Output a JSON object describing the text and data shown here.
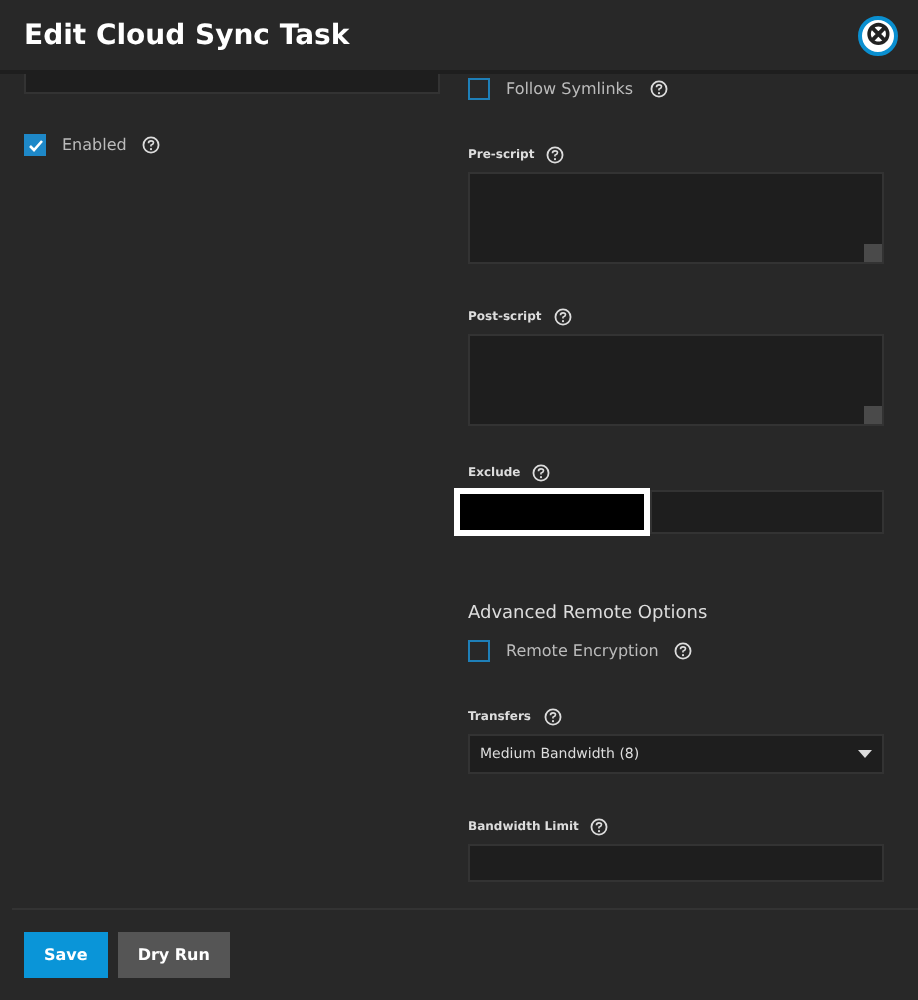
{
  "dialog": {
    "title": "Edit Cloud Sync Task",
    "close": "⊗"
  },
  "left": {
    "enabled": {
      "label": "Enabled",
      "checked": true
    }
  },
  "right": {
    "follow_symlinks": {
      "label": "Follow Symlinks",
      "checked": false
    },
    "pre_script": {
      "label": "Pre-script"
    },
    "post_script": {
      "label": "Post-script"
    },
    "exclude": {
      "label": "Exclude",
      "redacted": true
    },
    "advanced_heading": "Advanced Remote Options",
    "remote_encryption": {
      "label": "Remote Encryption",
      "checked": false
    },
    "transfers": {
      "label": "Transfers",
      "value": "Medium Bandwidth (8)"
    },
    "bandwidth_limit": {
      "label": "Bandwidth Limit"
    }
  },
  "buttons": [
    {
      "label": "Save",
      "kind": "primary"
    },
    {
      "label": "Dry Run",
      "kind": "secondary"
    }
  ]
}
